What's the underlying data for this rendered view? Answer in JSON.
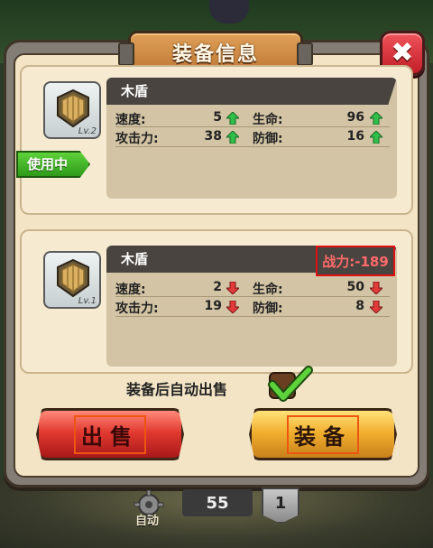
{
  "dialog": {
    "title": "装备信息",
    "close_icon": "close-x-icon"
  },
  "equipped": {
    "status_badge": "使用中",
    "item_name": "木盾",
    "level": "Lv.2",
    "icon": "wooden-shield-icon",
    "stats": [
      {
        "label": "速度:",
        "value": "5",
        "trend": "up"
      },
      {
        "label": "生命:",
        "value": "96",
        "trend": "up"
      },
      {
        "label": "攻击力:",
        "value": "38",
        "trend": "up"
      },
      {
        "label": "防御:",
        "value": "16",
        "trend": "up"
      }
    ]
  },
  "candidate": {
    "item_name": "木盾",
    "level": "Lv.1",
    "icon": "wooden-shield-icon",
    "power_change": "战力:-189",
    "stats": [
      {
        "label": "速度:",
        "value": "2",
        "trend": "down"
      },
      {
        "label": "生命:",
        "value": "50",
        "trend": "down"
      },
      {
        "label": "攻击力:",
        "value": "19",
        "trend": "down"
      },
      {
        "label": "防御:",
        "value": "8",
        "trend": "down"
      }
    ]
  },
  "auto_sell": {
    "label": "装备后自动出售",
    "checked": true
  },
  "buttons": {
    "sell": "出售",
    "equip": "装备"
  },
  "bottom_bar": {
    "auto_label": "自动",
    "count": "55",
    "level": "1"
  },
  "colors": {
    "up_arrow": "#2fbf4a",
    "down_arrow": "#e23a3a",
    "sell_button": "#e23a30",
    "equip_button": "#f2b030"
  }
}
